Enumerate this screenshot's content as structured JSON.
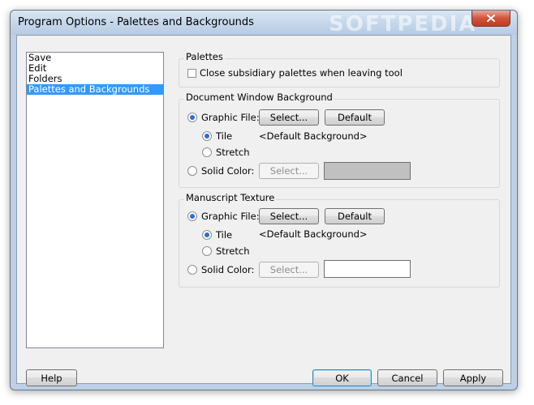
{
  "window": {
    "title": "Program Options - Palettes and Backgrounds",
    "watermark": "SOFTPEDIA"
  },
  "sidebar": {
    "items": [
      {
        "label": "Save"
      },
      {
        "label": "Edit"
      },
      {
        "label": "Folders"
      },
      {
        "label": "Palettes and Backgrounds",
        "selected": true
      }
    ]
  },
  "palettes": {
    "group_label": "Palettes",
    "close_subsidiary_label": "Close subsidiary palettes when leaving tool",
    "close_subsidiary_checked": false
  },
  "document_bg": {
    "group_label": "Document Window Background",
    "graphic_file_label": "Graphic File:",
    "graphic_file_selected": true,
    "select_label": "Select...",
    "default_label": "Default",
    "tile_label": "Tile",
    "tile_selected": true,
    "stretch_label": "Stretch",
    "file_value": "<Default Background>",
    "solid_color_label": "Solid Color:",
    "solid_select_label": "Select...",
    "solid_color": "#c0c0c0"
  },
  "manuscript": {
    "group_label": "Manuscript Texture",
    "graphic_file_label": "Graphic File:",
    "graphic_file_selected": true,
    "select_label": "Select...",
    "default_label": "Default",
    "tile_label": "Tile",
    "tile_selected": true,
    "stretch_label": "Stretch",
    "file_value": "<Default Background>",
    "solid_color_label": "Solid Color:",
    "solid_select_label": "Select...",
    "solid_color": "#ffffff"
  },
  "footer": {
    "help_label": "Help",
    "ok_label": "OK",
    "cancel_label": "Cancel",
    "apply_label": "Apply"
  }
}
